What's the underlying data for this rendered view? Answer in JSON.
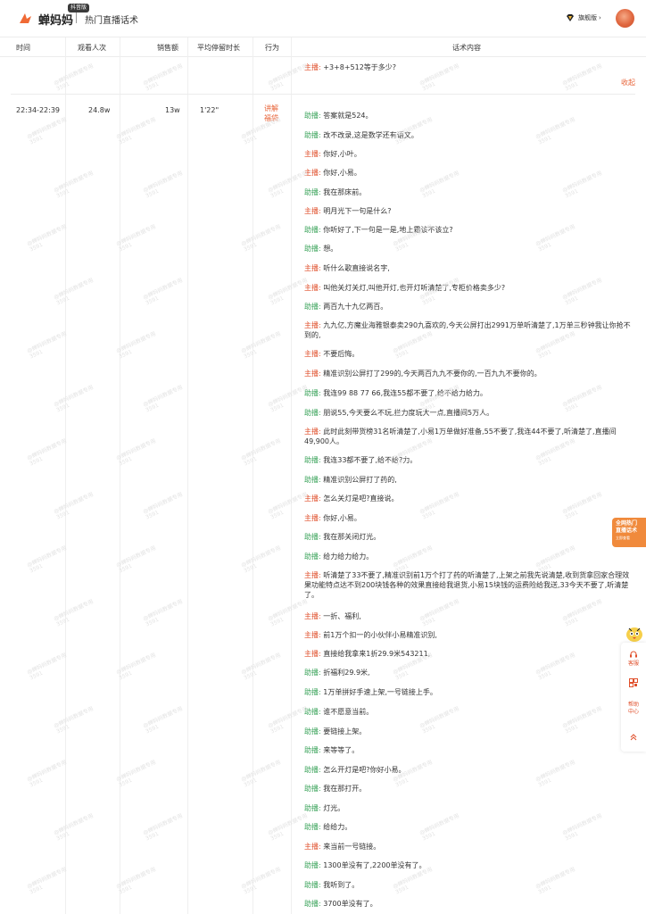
{
  "header": {
    "brand_name": "蝉妈妈",
    "brand_badge": "抖音版",
    "title": "热门直播话术",
    "vip_label": "旗舰版",
    "vip_caret": "›"
  },
  "table": {
    "columns": [
      "时间",
      "观看人次",
      "销售额",
      "平均停留时长",
      "行为",
      "话术内容"
    ],
    "collapse_label": "收起",
    "row0_last_line": {
      "role": "主播:",
      "text": "+3+8+512等于多少?"
    },
    "row1": {
      "time": "22:34-22:39",
      "views": "24.8w",
      "sales": "13w",
      "avg_stay": "1'22\"",
      "action": "讲解\n福袋",
      "lines": [
        {
          "role": "助播:",
          "text": "答案就是524。"
        },
        {
          "role": "助播:",
          "text": "改不改录,这是数学还有语文。"
        },
        {
          "role": "主播:",
          "text": "你好,小叶。"
        },
        {
          "role": "主播:",
          "text": "你好,小易。"
        },
        {
          "role": "助播:",
          "text": "我在那床前。"
        },
        {
          "role": "主播:",
          "text": "明月光下一句是什么?"
        },
        {
          "role": "助播:",
          "text": "你听好了,下一句是一是,地上霜该不该立?"
        },
        {
          "role": "助播:",
          "text": "想。"
        },
        {
          "role": "主播:",
          "text": "听什么歌直接说名字,"
        },
        {
          "role": "主播:",
          "text": "叫他关灯关灯,叫他开灯,也开灯听清楚了,专柜价格卖多少?"
        },
        {
          "role": "助播:",
          "text": "两百九十九亿两百。"
        },
        {
          "role": "主播:",
          "text": "九九亿,方魔业海雅银泰卖290九喜欢的,今天公屏打出2991万单听清楚了,1万单三秒钟我让你抢不到的,"
        },
        {
          "role": "主播:",
          "text": "不要后悔。"
        },
        {
          "role": "主播:",
          "text": "精准识别公屏打了299的,今天两百九九不要你的,一百九九不要你的。"
        },
        {
          "role": "助播:",
          "text": "我连99 88 77 66,我连55都不要了,给不给力给力。"
        },
        {
          "role": "助播:",
          "text": "朋说55,今天要么不玩,拦力度玩大一点,直播间5万人。"
        },
        {
          "role": "主播:",
          "text": "此时此刻带货榜31名听清楚了,小易1万单做好准备,55不要了,我连44不要了,听清楚了,直播间49,900人。"
        },
        {
          "role": "助播:",
          "text": "我连33都不要了,给不给?力。"
        },
        {
          "role": "助播:",
          "text": "精准识别公屏打了药的,"
        },
        {
          "role": "主播:",
          "text": "怎么关灯是吧?直接说。"
        },
        {
          "role": "主播:",
          "text": "你好,小易。"
        },
        {
          "role": "助播:",
          "text": "我在那关闭灯光。"
        },
        {
          "role": "助播:",
          "text": "给力给力给力。"
        },
        {
          "role": "主播:",
          "text": "听清楚了33不要了,精准识别前1万个打了药的听清楚了,上架之前我先说清楚,收到货拿回家合理效果功能特点达不到200块钱各种的效果直接给我退货,小易15块钱的运费险给我送,33今天不要了,听清楚了。"
        },
        {
          "role": "主播:",
          "text": "一折、福利,"
        },
        {
          "role": "主播:",
          "text": "前1万个扣一的小伙伴小易精准识别,"
        },
        {
          "role": "主播:",
          "text": "直接给我拿来1折29.9米543211,"
        },
        {
          "role": "助播:",
          "text": "折福利29.9米,"
        },
        {
          "role": "助播:",
          "text": "1万单拼好手速上架,一号链接上手。"
        },
        {
          "role": "助播:",
          "text": "谁不愿意当前。"
        },
        {
          "role": "助播:",
          "text": "要链接上架。"
        },
        {
          "role": "助播:",
          "text": "来等等了。"
        },
        {
          "role": "助播:",
          "text": "怎么开灯是吧?你好小易。"
        },
        {
          "role": "助播:",
          "text": "我在那打开。"
        },
        {
          "role": "助播:",
          "text": "灯光。"
        },
        {
          "role": "助播:",
          "text": "给给力。"
        },
        {
          "role": "主播:",
          "text": "来当前一号链接。"
        },
        {
          "role": "助播:",
          "text": "1300单没有了,2200单没有了。"
        },
        {
          "role": "助播:",
          "text": "我听到了。"
        },
        {
          "role": "助播:",
          "text": "3700单没有了。"
        }
      ]
    }
  },
  "watermark": {
    "line1": "@蝉妈妈数据专用",
    "line2": "3591"
  },
  "promo": {
    "line1": "全网热门",
    "line2": "直播话术",
    "sub": "立即查看"
  },
  "side_panel": {
    "feedback": "客服",
    "help": "帮助中心"
  },
  "colors": {
    "accent": "#e8653a",
    "host": "#e0502c",
    "assistant": "#3aa35a"
  }
}
